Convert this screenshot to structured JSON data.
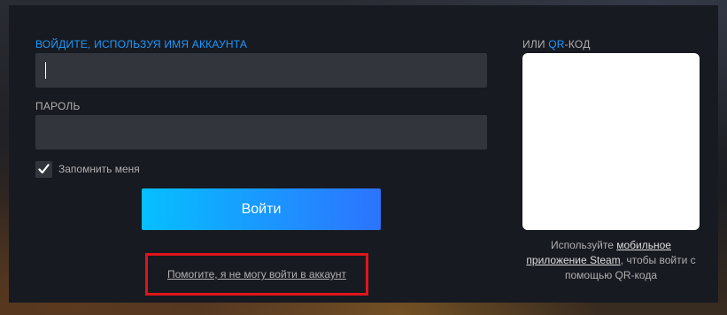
{
  "login": {
    "account_label": "ВОЙДИТЕ, ИСПОЛЬЗУЯ ИМЯ АККАУНТА",
    "account_value": "",
    "password_label": "ПАРОЛЬ",
    "password_value": "",
    "remember_label": "Запомнить меня",
    "remember_checked": true,
    "signin_label": "Войти",
    "help_link": "Помогите, я не могу войти в аккаунт"
  },
  "qr": {
    "label_prefix": "ИЛИ ",
    "label_accent": "QR",
    "label_suffix": "-КОД",
    "caption_before": "Используйте ",
    "caption_link": "мобильное приложение Steam",
    "caption_after": ", чтобы войти с помощью QR-кода"
  },
  "colors": {
    "accent": "#1999ff",
    "highlight_box": "#e1141b",
    "button_gradient_start": "#06bfff",
    "button_gradient_end": "#2d73ff"
  },
  "icons": {
    "checkbox": "checkmark-icon"
  }
}
